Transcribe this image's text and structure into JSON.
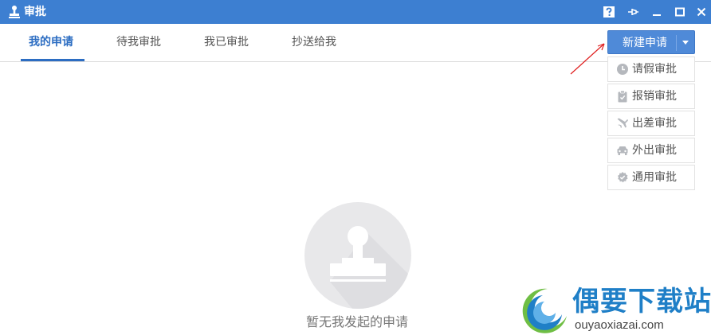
{
  "window": {
    "title": "审批",
    "controls": [
      "help-icon",
      "pin-icon",
      "minimize-icon",
      "maximize-icon",
      "close-icon"
    ]
  },
  "tabs": [
    {
      "label": "我的申请",
      "active": true
    },
    {
      "label": "待我审批",
      "active": false
    },
    {
      "label": "我已审批",
      "active": false
    },
    {
      "label": "抄送给我",
      "active": false
    }
  ],
  "new_request": {
    "label": "新建申请",
    "menu": [
      {
        "label": "请假审批",
        "icon": "clock-icon"
      },
      {
        "label": "报销审批",
        "icon": "clipboard-icon"
      },
      {
        "label": "出差审批",
        "icon": "plane-icon"
      },
      {
        "label": "外出审批",
        "icon": "car-icon"
      },
      {
        "label": "通用审批",
        "icon": "badge-check-icon"
      }
    ]
  },
  "empty_state": {
    "icon": "stamp-icon",
    "text": "暂无我发起的申请"
  },
  "watermark": {
    "title": "偶要下载站",
    "url": "ouyaoxiazai.com"
  },
  "colors": {
    "titlebar": "#3d7fd1",
    "accent": "#2c6dc2",
    "button": "#4f8ad8",
    "annotation_arrow": "#e02020",
    "menu_icon": "#b5b8bd"
  }
}
